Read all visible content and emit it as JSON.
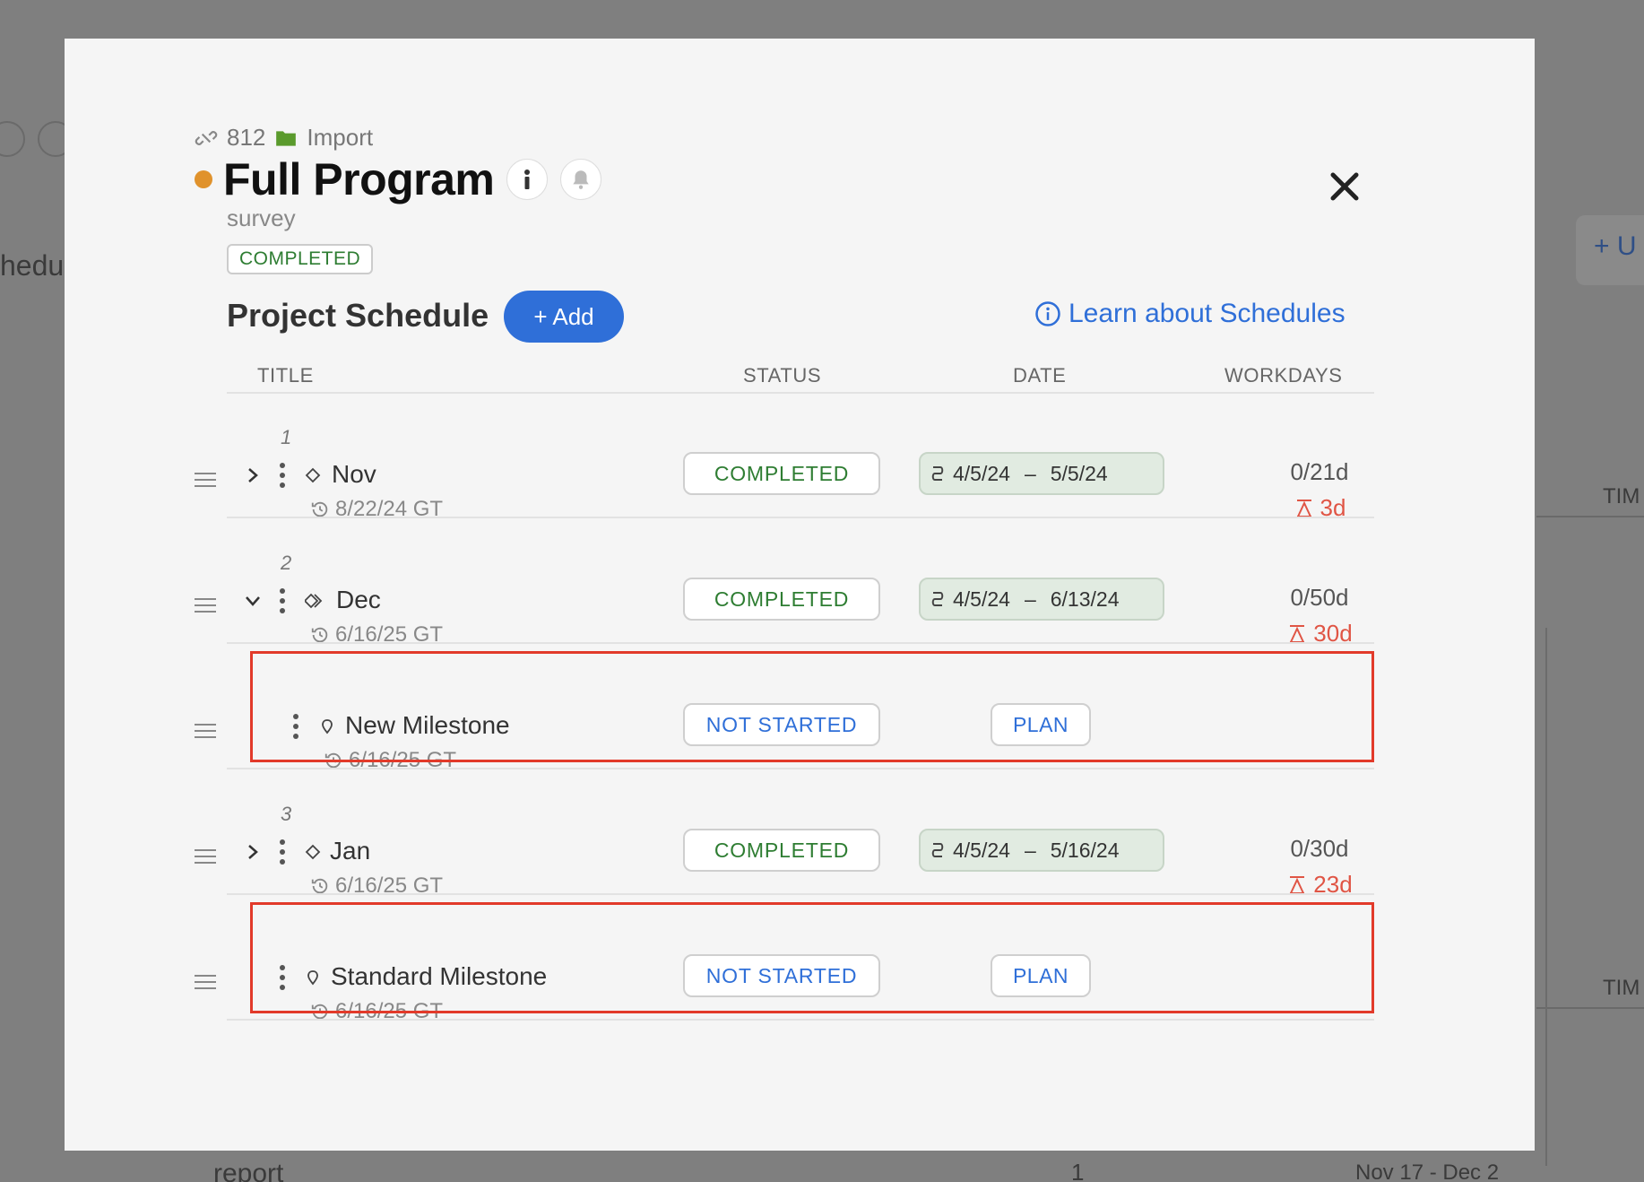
{
  "background": {
    "partial_text_left": "hedu",
    "partial_button": "+ U",
    "col_label_1": "TIM",
    "col_label_2": "TIM",
    "bottom_left": "report",
    "bottom_count": "1",
    "bottom_right": "Nov 17 - Dec 2"
  },
  "modal": {
    "id": "812",
    "folder": "Import",
    "title": "Full Program",
    "subtitle": "survey",
    "status": "COMPLETED",
    "status_dot_color": "#e0922c"
  },
  "schedule": {
    "heading": "Project Schedule",
    "add_label": "+ Add",
    "learn_label": "Learn about Schedules",
    "columns": [
      "TITLE",
      "STATUS",
      "DATE",
      "WORKDAYS"
    ],
    "rows": [
      {
        "num": "1",
        "title": "Nov",
        "sub": "8/22/24 GT",
        "status": "COMPLETED",
        "date_start": "4/5/24",
        "date_sep": "–",
        "date_end": "5/5/24",
        "workdays": "0/21d",
        "late": "3d"
      },
      {
        "num": "2",
        "title": "Dec",
        "sub": "6/16/25 GT",
        "status": "COMPLETED",
        "date_start": "4/5/24",
        "date_sep": "–",
        "date_end": "6/13/24",
        "workdays": "0/50d",
        "late": "30d"
      },
      {
        "title": "New Milestone",
        "sub": "6/16/25 GT",
        "status": "NOT STARTED",
        "plan": "PLAN"
      },
      {
        "num": "3",
        "title": "Jan",
        "sub": "6/16/25 GT",
        "status": "COMPLETED",
        "date_start": "4/5/24",
        "date_sep": "–",
        "date_end": "5/16/24",
        "workdays": "0/30d",
        "late": "23d"
      },
      {
        "title": "Standard Milestone",
        "sub": "6/16/25 GT",
        "status": "NOT STARTED",
        "plan": "PLAN"
      }
    ]
  },
  "colors": {
    "accent": "#2f6fd8",
    "completed": "#2e7d32",
    "late": "#e05545",
    "highlight": "#e23a2a"
  }
}
